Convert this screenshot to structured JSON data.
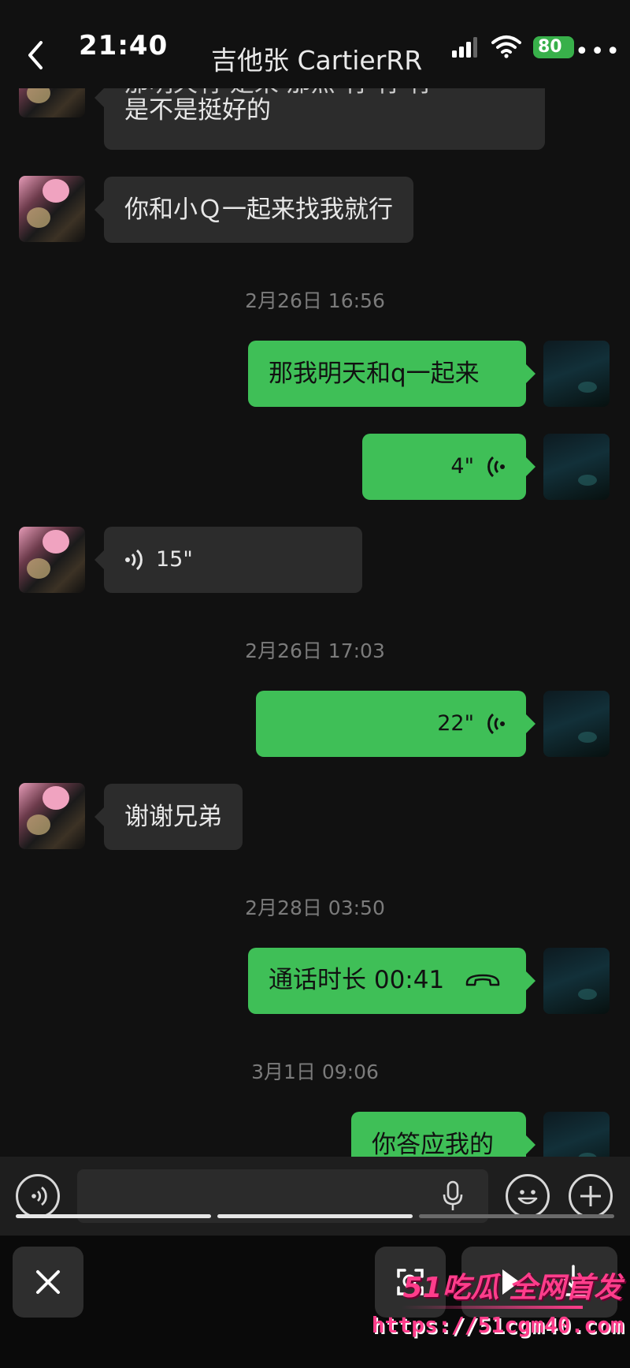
{
  "status_bar": {
    "time": "21:40",
    "battery": "80"
  },
  "header": {
    "title": "吉他张 CartierRR"
  },
  "messages": {
    "m1_line1": "那明天有 是来 那点 有  有 有  ",
    "m1_line2": "是不是挺好的",
    "m2": "你和小Ｑ一起来找我就行",
    "ts1": "2月26日 16:56",
    "m3": "那我明天和q一起来",
    "m4_duration": "4\"",
    "m5_duration": "15\"",
    "ts2": "2月26日 17:03",
    "m6_duration": "22\"",
    "m7": "谢谢兄弟",
    "ts3": "2月28日 03:50",
    "m8": "通话时长 00:41",
    "ts4": "3月1日 09:06",
    "m9": "你答应我的"
  },
  "input": {
    "placeholder": ""
  },
  "watermark": {
    "brand": "51吃瓜 全网首发",
    "url": "https://51cgm40.com"
  },
  "colors": {
    "background": "#111111",
    "incoming_bubble": "#2c2c2c",
    "outgoing_bubble": "#3fbf57",
    "timestamp": "#7b7b7b",
    "watermark": "#ff3d8b",
    "battery": "#38b04a"
  },
  "icons": [
    "back-chevron-icon",
    "signal-icon",
    "wifi-icon",
    "battery-icon",
    "more-icon",
    "voice-wave-icon",
    "phone-hangup-icon",
    "voice-mode-icon",
    "microphone-icon",
    "emoji-icon",
    "plus-icon",
    "close-icon",
    "scan-icon",
    "play-icon",
    "download-icon"
  ]
}
